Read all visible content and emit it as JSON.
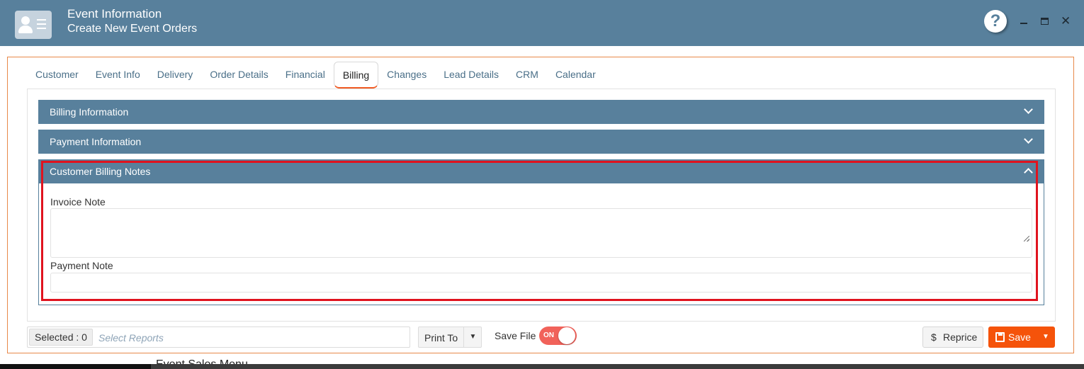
{
  "window": {
    "title": "Event Information",
    "subtitle": "Create New Event Orders",
    "help_glyph": "?",
    "close_glyph": "✕",
    "brand_color": "#58809c"
  },
  "tabs": [
    {
      "label": "Customer",
      "active": false
    },
    {
      "label": "Event Info",
      "active": false
    },
    {
      "label": "Delivery",
      "active": false
    },
    {
      "label": "Order Details",
      "active": false
    },
    {
      "label": "Financial",
      "active": false
    },
    {
      "label": "Billing",
      "active": true
    },
    {
      "label": "Changes",
      "active": false
    },
    {
      "label": "Lead Details",
      "active": false
    },
    {
      "label": "CRM",
      "active": false
    },
    {
      "label": "Calendar",
      "active": false
    }
  ],
  "panels": {
    "billing_information": {
      "title": "Billing Information",
      "expanded": false
    },
    "payment_information": {
      "title": "Payment Information",
      "expanded": false
    },
    "customer_billing_notes": {
      "title": "Customer Billing Notes",
      "expanded": true,
      "invoice_note_label": "Invoice Note",
      "invoice_note_value": "",
      "payment_note_label": "Payment Note",
      "payment_note_value": ""
    }
  },
  "footer": {
    "selected_label": "Selected : 0",
    "reports_placeholder": "Select Reports",
    "print_to_label": "Print To",
    "print_caret": "▼",
    "save_file_label": "Save File",
    "save_file_toggle": "ON",
    "reprice_symbol": "$",
    "reprice_label": "Reprice",
    "save_label": "Save",
    "save_caret": "▼",
    "accent_color": "#f5530a"
  },
  "taskbar_text": "Event Sales Menu"
}
